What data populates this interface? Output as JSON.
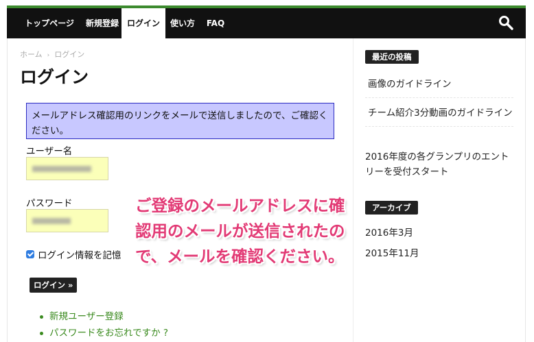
{
  "nav": {
    "items": [
      "トップページ",
      "新規登録",
      "ログイン",
      "使い方",
      "FAQ"
    ],
    "active_index": 2,
    "search_icon": "search-icon",
    "accent_color": "#3c8a2e"
  },
  "breadcrumb": {
    "home": "ホーム",
    "separator": "›",
    "current": "ログイン"
  },
  "page": {
    "title": "ログイン"
  },
  "message": "メールアドレス確認用のリンクをメールで送信しましたので、ご確認ください。",
  "form": {
    "username_label": "ユーザー名",
    "password_label": "パスワード",
    "remember_label": "ログイン情報を記憶",
    "remember_checked": true,
    "login_button": "ログイン »"
  },
  "links": [
    "新規ユーザー登録",
    "パスワードをお忘れですか ?"
  ],
  "annotation": "ご登録のメールアドレスに確認用のメールが送信されたので、メールを確認ください。",
  "sidebar": {
    "recent_heading": "最近の投稿",
    "recent_posts": [
      "画像のガイドライン",
      "チーム紹介3分動画のガイドライン"
    ],
    "entry_text": "2016年度の各グランプリのエントリーを受付スタート",
    "archive_heading": "アーカイブ",
    "archives": [
      "2016年3月",
      "2015年11月"
    ]
  }
}
